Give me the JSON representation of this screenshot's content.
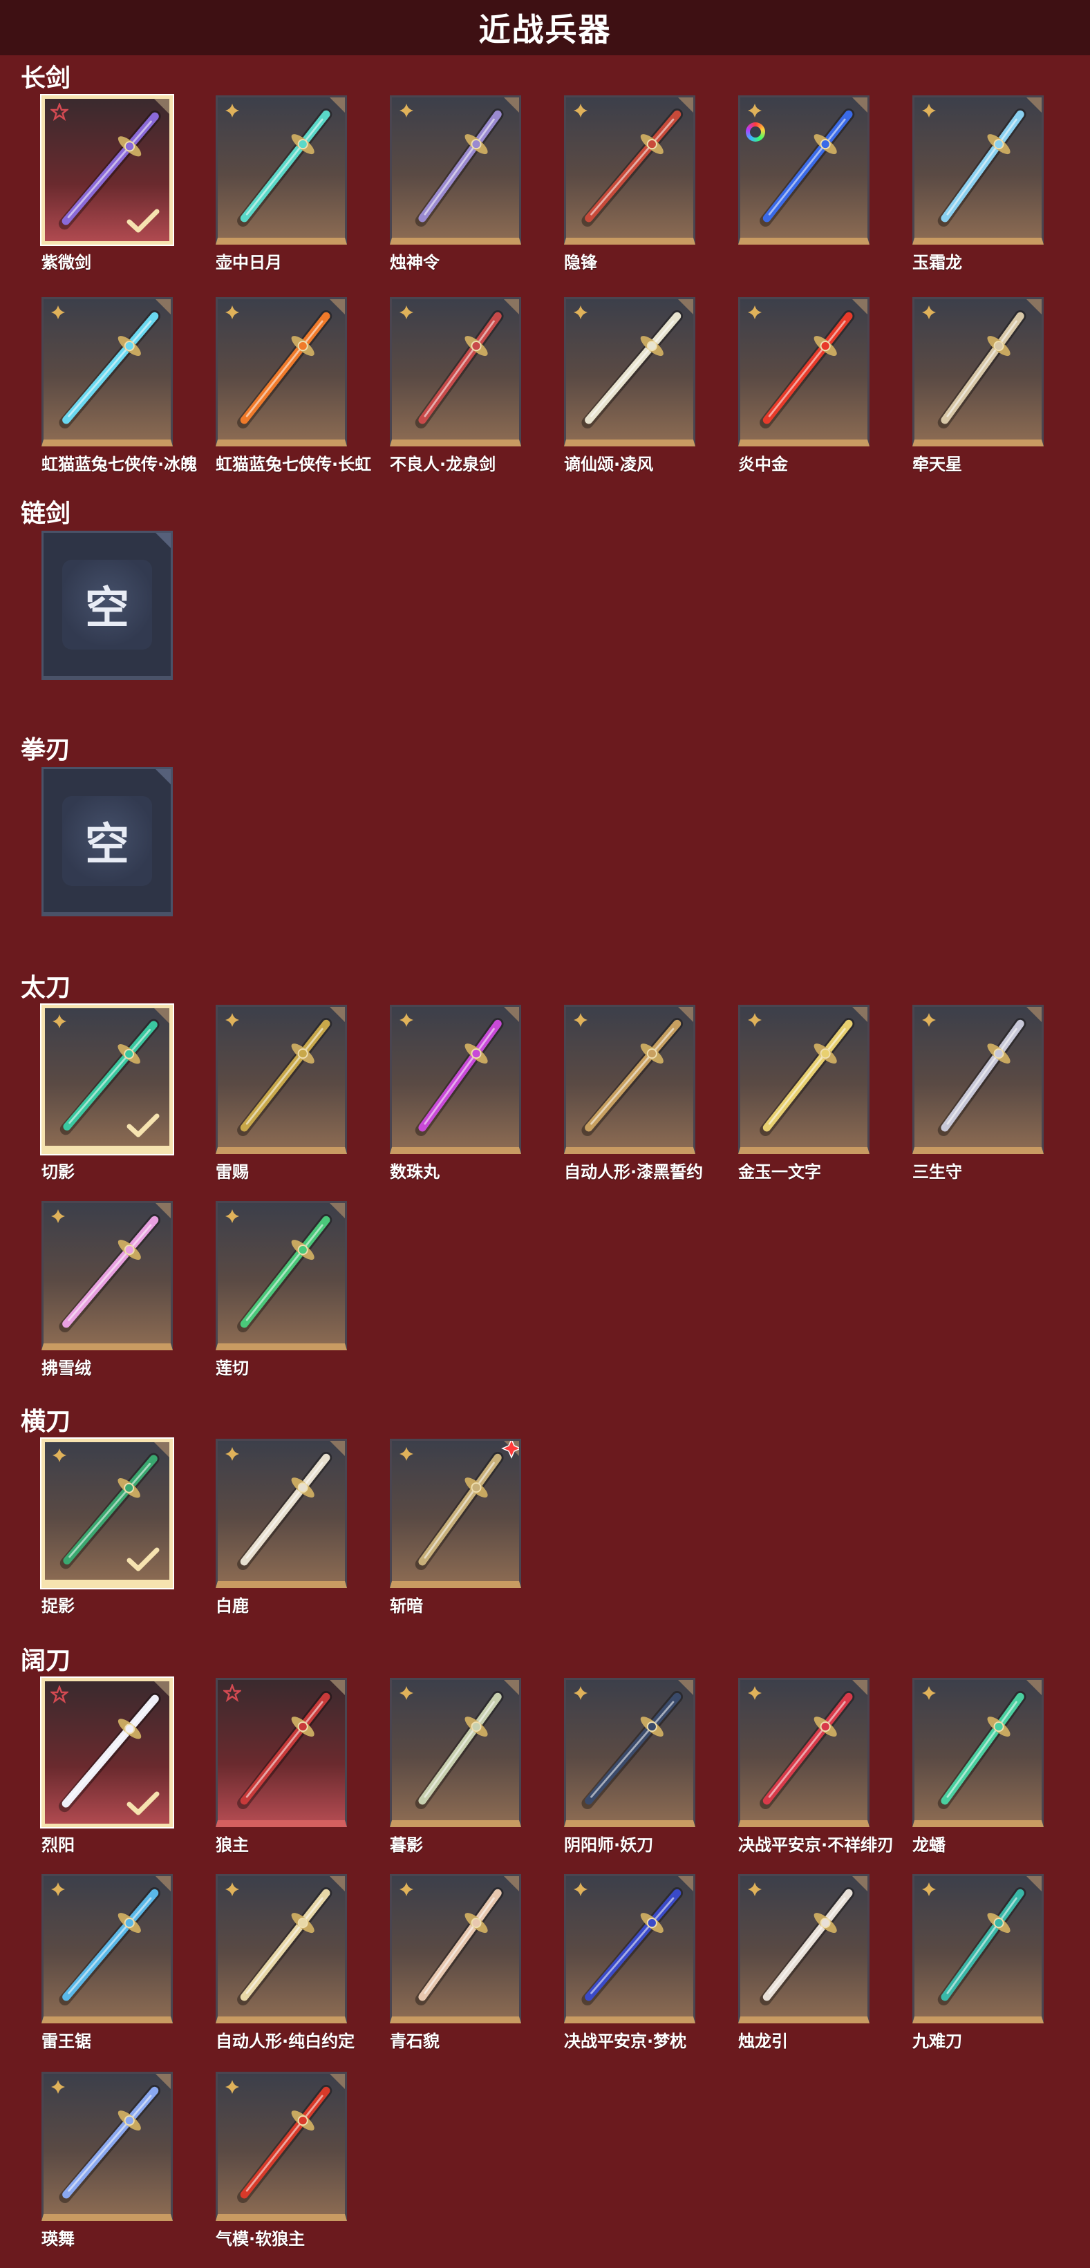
{
  "header": {
    "title": "近战兵器"
  },
  "colors": {
    "background": "#6b1a1e",
    "header": "#3e1013",
    "gold_rarity": "#e0b25a",
    "red_rarity": "#d54a52",
    "selected_border": "#f6e3b0"
  },
  "empty_label": "空",
  "sections": [
    {
      "title": "长剑",
      "items": [
        {
          "name": "紫微剑",
          "rarity": "red",
          "selected": true,
          "hue": "#8a6ad8"
        },
        {
          "name": "壶中日月",
          "rarity": "gold",
          "hue": "#5ad8c8"
        },
        {
          "name": "烛神令",
          "rarity": "gold",
          "hue": "#9a8ad0"
        },
        {
          "name": "隐锋",
          "rarity": "gold",
          "hue": "#c84a3a"
        },
        {
          "name": "",
          "rarity": "gold",
          "ring": true,
          "hue": "#3a6ae8"
        },
        {
          "name": "玉霜龙",
          "rarity": "gold",
          "hue": "#8ad0f0"
        },
        {
          "name": "虹猫蓝兔七侠传·冰魄",
          "rarity": "gold",
          "hue": "#6ad8f0"
        },
        {
          "name": "虹猫蓝兔七侠传·长虹",
          "rarity": "gold",
          "hue": "#f07a2a"
        },
        {
          "name": "不良人·龙泉剑",
          "rarity": "gold",
          "hue": "#c84a4a"
        },
        {
          "name": "谪仙颂·凌风",
          "rarity": "gold",
          "hue": "#e8e4d0"
        },
        {
          "name": "炎中金",
          "rarity": "gold",
          "hue": "#e83a2a"
        },
        {
          "name": "牵天星",
          "rarity": "gold",
          "hue": "#d8c8a8"
        }
      ]
    },
    {
      "title": "链剑",
      "items": [
        {
          "empty": true
        }
      ]
    },
    {
      "title": "拳刃",
      "items": [
        {
          "empty": true
        }
      ]
    },
    {
      "title": "太刀",
      "items": [
        {
          "name": "切影",
          "rarity": "gold",
          "selected": true,
          "hue": "#3ac8a0"
        },
        {
          "name": "雷赐",
          "rarity": "gold",
          "hue": "#c8a84a"
        },
        {
          "name": "数珠丸",
          "rarity": "gold",
          "hue": "#c84ad8"
        },
        {
          "name": "自动人形·漆黑誓约",
          "rarity": "gold",
          "hue": "#c8a060"
        },
        {
          "name": "金玉一文字",
          "rarity": "gold",
          "hue": "#e8d070"
        },
        {
          "name": "三生守",
          "rarity": "gold",
          "hue": "#c8c8d8"
        },
        {
          "name": "拂雪绒",
          "rarity": "gold",
          "hue": "#e8a0e0"
        },
        {
          "name": "莲切",
          "rarity": "gold",
          "hue": "#4ac87a"
        }
      ]
    },
    {
      "title": "横刀",
      "items": [
        {
          "name": "捉影",
          "rarity": "gold",
          "selected": true,
          "hue": "#3aa870"
        },
        {
          "name": "白鹿",
          "rarity": "gold",
          "hue": "#e8e0d0"
        },
        {
          "name": "斩暗",
          "rarity": "gold",
          "new": true,
          "hue": "#c8b07a"
        }
      ]
    },
    {
      "title": "阔刀",
      "items": [
        {
          "name": "烈阳",
          "rarity": "red",
          "selected": true,
          "hue": "#f0f0f8"
        },
        {
          "name": "狼主",
          "rarity": "red",
          "hue": "#c83a3a"
        },
        {
          "name": "暮影",
          "rarity": "gold",
          "hue": "#c8d0b0"
        },
        {
          "name": "阴阳师·妖刀",
          "rarity": "gold",
          "hue": "#3a4a6a"
        },
        {
          "name": "决战平安京·不祥绯刃",
          "rarity": "gold",
          "hue": "#d83a4a"
        },
        {
          "name": "龙蟠",
          "rarity": "gold",
          "hue": "#4ad0a0"
        },
        {
          "name": "雷王锯",
          "rarity": "gold",
          "hue": "#5ab8e8"
        },
        {
          "name": "自动人形·纯白约定",
          "rarity": "gold",
          "hue": "#e8d8a8"
        },
        {
          "name": "青石貌",
          "rarity": "gold",
          "hue": "#e8c8b0"
        },
        {
          "name": "决战平安京·梦枕",
          "rarity": "gold",
          "hue": "#3a4ac8"
        },
        {
          "name": "烛龙引",
          "rarity": "gold",
          "hue": "#e8e0d8"
        },
        {
          "name": "九难刀",
          "rarity": "gold",
          "hue": "#3ab8a8"
        },
        {
          "name": "瑛舞",
          "rarity": "gold",
          "hue": "#8aa8f0"
        },
        {
          "name": "气模·软狼主",
          "rarity": "gold",
          "hue": "#d83a2a"
        }
      ]
    }
  ]
}
